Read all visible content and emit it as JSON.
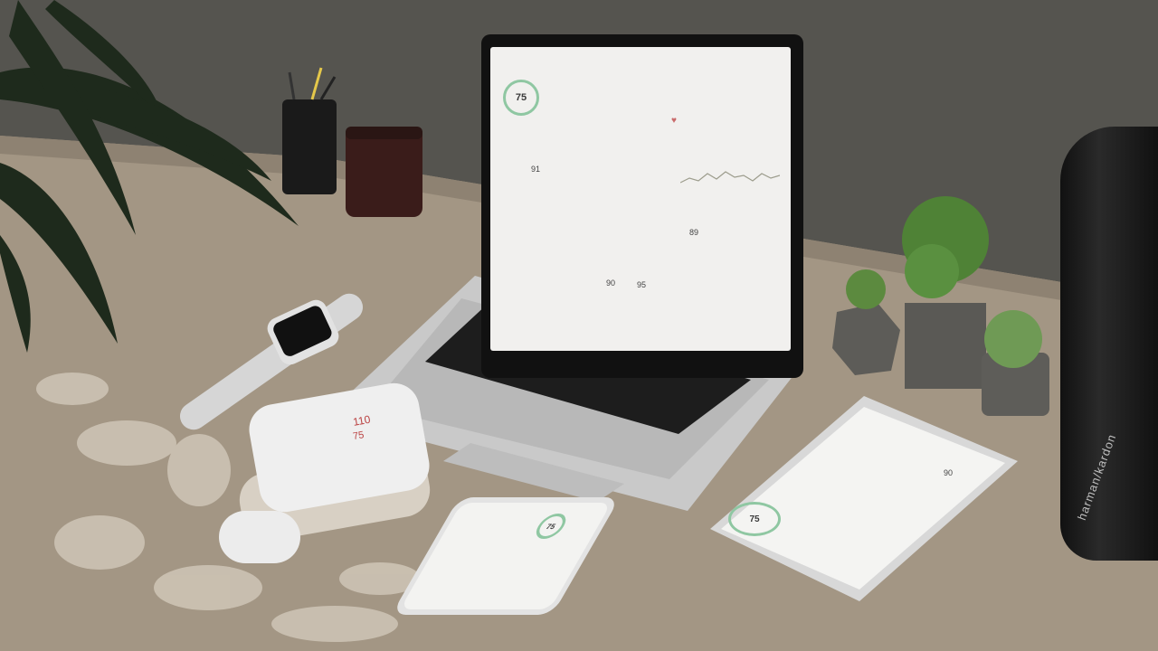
{
  "laptop_app": {
    "score": "75",
    "pulse": "91",
    "metric": "89",
    "metric2": "90",
    "metric3": "95"
  },
  "tablet_app": {
    "score": "75",
    "metric": "90"
  },
  "phone_app": {
    "score": "75"
  },
  "bp_monitor": {
    "systolic": "110",
    "diastolic": "75"
  },
  "speaker": {
    "brand": "harman/kardon"
  },
  "colors": {
    "accent_green": "#8fc7a2",
    "accent_red": "#c96a6a",
    "desk": "#a79886",
    "wall": "#55544f"
  }
}
